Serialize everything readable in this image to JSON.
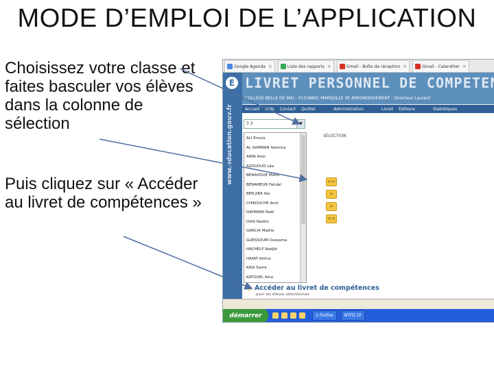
{
  "slide": {
    "title": "MODE D’EMPLOI DE L’APPLICATION",
    "instruction_1": "Choisissez votre classe et faites basculer vos élèves dans la colonne de sélection",
    "instruction_2": "Puis cliquez sur « Accéder au livret de compétences »"
  },
  "browser": {
    "tabs": [
      {
        "label": "Google Agenda",
        "color": "#4a86e8"
      },
      {
        "label": "Liste des rapports",
        "color": "#34a853"
      },
      {
        "label": "Gmail - Boîte de réception",
        "color": "#d93025"
      },
      {
        "label": "Gmail - Calendrier",
        "color": "#d93025"
      }
    ]
  },
  "app": {
    "logo_glyph": "É",
    "side_text": "www.education.gouv.fr",
    "title": "LIVRET PERSONNEL DE COMPETENCES",
    "school_line": "COLLEGE BELLE DE MAI - 0131880C MARSEILLE 3E ARRONDISSEMENT - Directeur Laurent",
    "menu": [
      "Accueil",
      "Aide",
      "Contact",
      "Quitter",
      "Administration",
      "Livret",
      "Éditions",
      "Statistiques"
    ],
    "class_select_value": "3 3",
    "selection_label": "SÉLECTION",
    "students": [
      "ALI Eroula",
      "AL-SAMMAN Yasmine",
      "AMIR Amir",
      "AZOUOUD Lâa",
      "BENAHOUE Mohd",
      "BENAMEUR Fahdal",
      "BEN JIBA Ida",
      "CHIKOUCHE Amir",
      "DAHMANI Noël",
      "DIAS Nadim",
      "GARCIA Maëlle",
      "GUESSOUM Oussama",
      "HACHELF Nadjib",
      "HAYAT Arthur",
      "KASI Samir",
      "KATOUEL Aïna"
    ],
    "move_buttons": [
      ">>",
      ">",
      "<",
      "<<"
    ],
    "access_button": "Accéder au livret de compétences",
    "access_sub": "pour les élèves sélectionnés",
    "taskbar": {
      "start": "démarrer",
      "tasks": [
        "2 Firefox",
        "NTFD 1F"
      ]
    }
  }
}
